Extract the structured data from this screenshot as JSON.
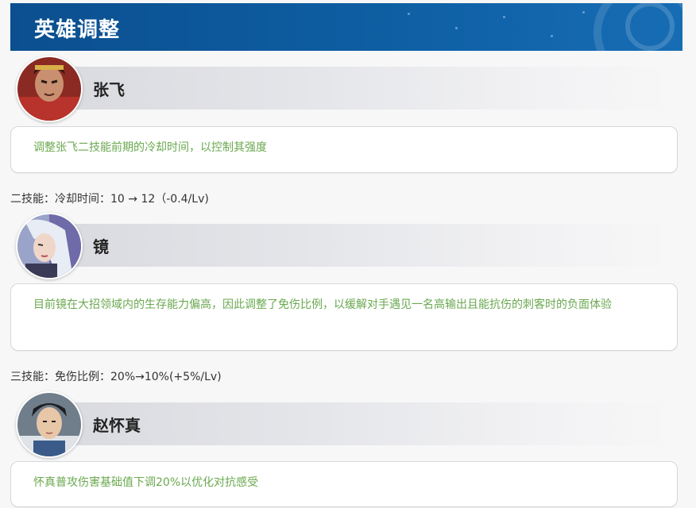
{
  "header": {
    "title": "英雄调整"
  },
  "heroes": [
    {
      "name": "张飞",
      "avatar": "zhangfei-portrait",
      "description": "调整张飞二技能前期的冷却时间，以控制其强度",
      "change": "二技能：冷却时间：10 → 12（-0.4/Lv)"
    },
    {
      "name": "镜",
      "avatar": "jing-portrait",
      "description": "目前镜在大招领域内的生存能力偏高，因此调整了免伤比例，以缓解对手遇见一名高输出且能抗伤的刺客时的负面体验",
      "change": "三技能：免伤比例：20%→10%(+5%/Lv)"
    },
    {
      "name": "赵怀真",
      "avatar": "zhaohuaizhen-portrait",
      "description": "怀真普攻伤害基础值下调20%以优化对抗感受"
    }
  ],
  "colors": {
    "header_bg": "#0e5ea3",
    "accent_text": "#6aa84f"
  }
}
